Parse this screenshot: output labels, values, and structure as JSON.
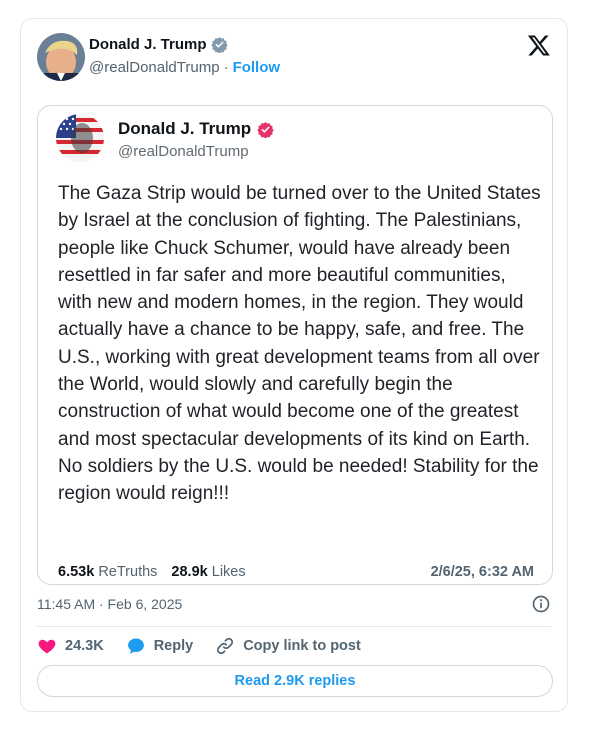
{
  "embed": {
    "author_name": "Donald J. Trump",
    "author_handle": "@realDonaldTrump",
    "separator": "·",
    "follow_label": "Follow",
    "platform_icon": "x-logo-icon"
  },
  "quote": {
    "author_name": "Donald J. Trump",
    "author_handle": "@realDonaldTrump",
    "text": "The Gaza Strip would be turned over to the United States by Israel at the conclusion of fighting. The Palestinians, people like Chuck Schumer, would have already been resettled in far safer and more beautiful communities, with new and modern homes, in the region. They would actually have a chance to be happy, safe, and free. The U.S., working with great development teams from all over the World, would slowly and carefully begin the construction of what would become one of the greatest and most spectacular developments of its kind on Earth. No soldiers by the U.S. would be needed! Stability for the region would reign!!!",
    "retruths_count": "6.53k",
    "retruths_label": "ReTruths",
    "likes_count": "28.9k",
    "likes_label": "Likes",
    "date": "2/6/25, 6:32 AM"
  },
  "meta": {
    "timestamp": "11:45 AM · Feb 6, 2025"
  },
  "actions": {
    "likes": "24.3K",
    "reply_label": "Reply",
    "copy_label": "Copy link to post"
  },
  "footer": {
    "read_replies_label": "Read 2.9K replies"
  },
  "colors": {
    "x_blue": "#1d9bf0",
    "verified_blue": "#1d9bf0",
    "truth_badge": "#e5336a",
    "heart": "#f91880"
  }
}
